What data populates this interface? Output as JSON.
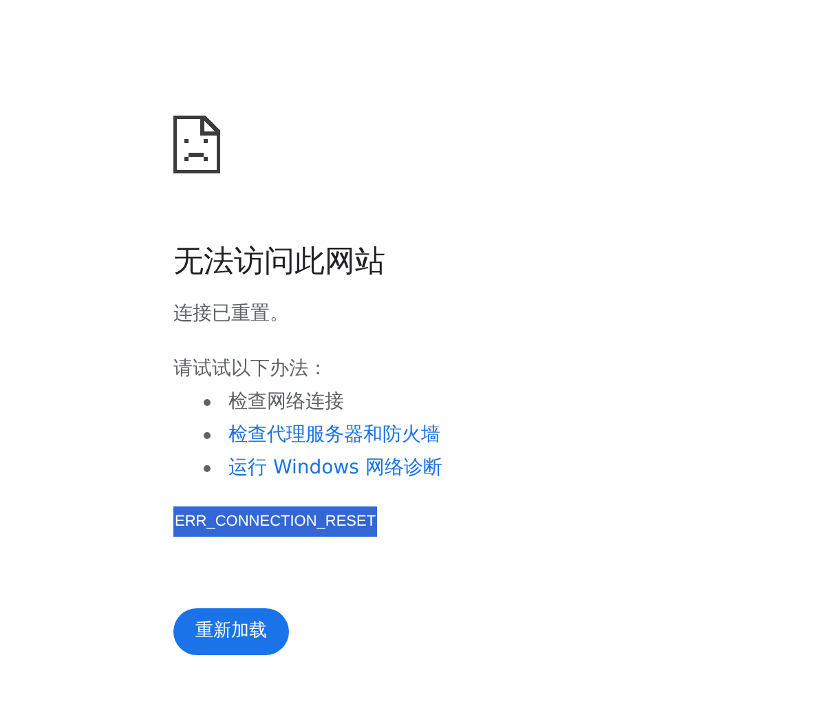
{
  "heading": "无法访问此网站",
  "message": "连接已重置。",
  "suggestions_intro": "请试试以下办法：",
  "suggestions": [
    {
      "kind": "text",
      "label": "检查网络连接"
    },
    {
      "kind": "link",
      "label": "检查代理服务器和防火墙"
    },
    {
      "kind": "link",
      "label": "运行 Windows 网络诊断"
    }
  ],
  "error_code": {
    "text": "ERR_CONNECTION_RESET",
    "selected": true
  },
  "reload_button": "重新加载"
}
